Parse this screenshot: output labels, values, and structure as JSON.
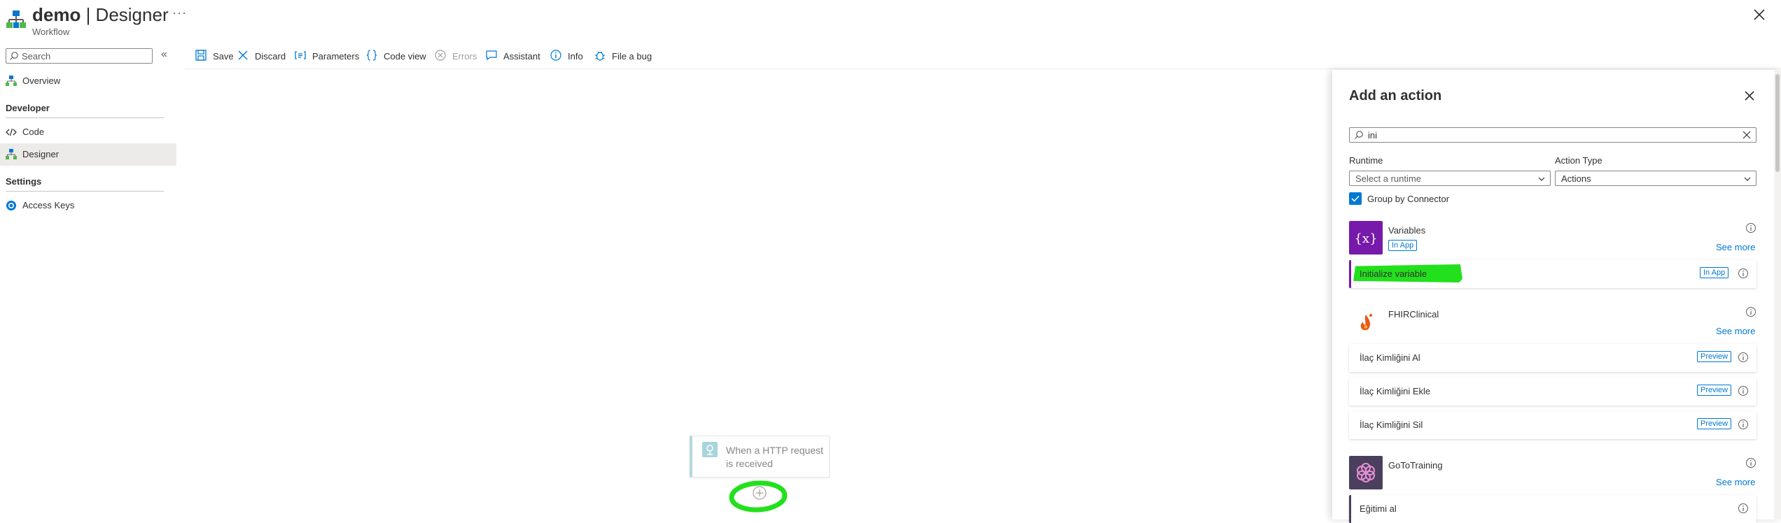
{
  "header": {
    "title_resource": "demo",
    "title_separator": " | ",
    "title_page": "Designer",
    "subtitle": "Workflow",
    "more_label": "···",
    "close_icon": "close-icon"
  },
  "sidebar": {
    "search_placeholder": "Search",
    "collapse_label": "«",
    "items_top": [
      {
        "label": "Overview",
        "icon": "overview-icon"
      }
    ],
    "sections": [
      {
        "heading": "Developer",
        "items": [
          {
            "label": "Code",
            "icon": "code-icon"
          },
          {
            "label": "Designer",
            "icon": "designer-icon",
            "selected": true
          }
        ]
      },
      {
        "heading": "Settings",
        "items": [
          {
            "label": "Access Keys",
            "icon": "key-icon"
          }
        ]
      }
    ]
  },
  "toolbar": {
    "save": "Save",
    "discard": "Discard",
    "parameters": "Parameters",
    "code_view": "Code view",
    "errors": "Errors",
    "assistant": "Assistant",
    "info": "Info",
    "file_bug": "File a bug"
  },
  "canvas": {
    "trigger_label": "When a HTTP request is received"
  },
  "panel": {
    "title": "Add an action",
    "search_value": "ini",
    "runtime_label": "Runtime",
    "runtime_placeholder": "Select a runtime",
    "action_type_label": "Action Type",
    "action_type_value": "Actions",
    "group_by_connector": "Group by Connector",
    "see_more": "See more",
    "connectors": [
      {
        "name": "Variables",
        "badge": "In App",
        "color": "#7719aa",
        "actions": [
          {
            "label": "Initialize variable",
            "badge": "In App",
            "highlighted": true
          }
        ]
      },
      {
        "name": "FHIRClinical",
        "actions": [
          {
            "label": "İlaç Kimliğini Al",
            "badge": "Preview"
          },
          {
            "label": "İlaç Kimliğini Ekle",
            "badge": "Preview"
          },
          {
            "label": "İlaç Kimliğini Sil",
            "badge": "Preview"
          }
        ]
      },
      {
        "name": "GoToTraining",
        "color": "#4a3f5c",
        "actions": [
          {
            "label": "Eğitimi al"
          }
        ]
      }
    ]
  },
  "colors": {
    "accent": "#0078d4",
    "variables_brand": "#7719aa",
    "gototraining_brand": "#4a3f5c",
    "annotation_highlight": "#23e01c"
  }
}
